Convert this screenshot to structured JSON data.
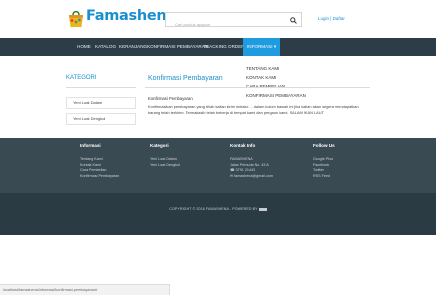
{
  "header": {
    "logo_text": "Famashena",
    "search_placeholder": "Cari produk apapun",
    "login_label": "Login | Daftar"
  },
  "nav": {
    "items": [
      {
        "label": "HOME"
      },
      {
        "label": "KATALOG"
      },
      {
        "label": "KERANJANG"
      },
      {
        "label": "KONFIRMASI PEMBAYARAN"
      },
      {
        "label": "TRACKING ORDER"
      },
      {
        "label": "INFORMASI"
      }
    ],
    "active_caret": "▾"
  },
  "dropdown": {
    "items": [
      {
        "label": "TENTANG KAMI"
      },
      {
        "label": "KONTAK KAMI"
      },
      {
        "label": "CARA PEMBELIAN"
      },
      {
        "label": "KONFIRMASI PEMBAYARAN"
      }
    ]
  },
  "sidebar": {
    "title": "KATEGORI",
    "items": [
      {
        "label": "Yeni Loat Dalam"
      },
      {
        "label": "Yeni Loat Dengkol"
      }
    ]
  },
  "content": {
    "title": "Konfirmasi Pembayaran",
    "subtitle": "Konfirmasi Pembayaran",
    "body": "Konfirmasikan pembayaran yang telah kalian kirim melalui ... dalam kolom bawah ini jika kalian akan segera mendapatkan barang telah terkirim. Termakasih telah bekerja di tempat kami dan pergaun kami. SALAM IKAN LAUT"
  },
  "footer": {
    "columns": [
      {
        "heading": "Informasi",
        "lines": [
          "Tentang Kami",
          "Kontak Kami",
          "Cara Pembelian",
          "Konfirmasi Pembayaran"
        ]
      },
      {
        "heading": "Kategori",
        "lines": [
          "Yeni Loat Dalam",
          "Yeni Loat Dengkol"
        ]
      },
      {
        "heading": "Kontak Info",
        "lines": [
          "FAMASHENA",
          "Jalan Pemuda No. 43 A",
          "0791 21443",
          "famashena@gmail.com"
        ]
      },
      {
        "heading": "Follow Us",
        "lines": [
          "Google Plus",
          "Facebook",
          "Twitter",
          "RSS Feed"
        ]
      }
    ],
    "copyright": "COPYRIGHT © 2016 FAMASHENA - POWERED BY"
  },
  "status_bar": {
    "url": "localhost/famashena/informasi/konfirmasi-pembayaran#"
  },
  "colors": {
    "brand_blue": "#1a8fcf",
    "nav_bg": "#2c3d47",
    "nav_active": "#1f9be0",
    "footer_bg": "#3a4a53",
    "copyright_bg": "#2b3b44"
  }
}
